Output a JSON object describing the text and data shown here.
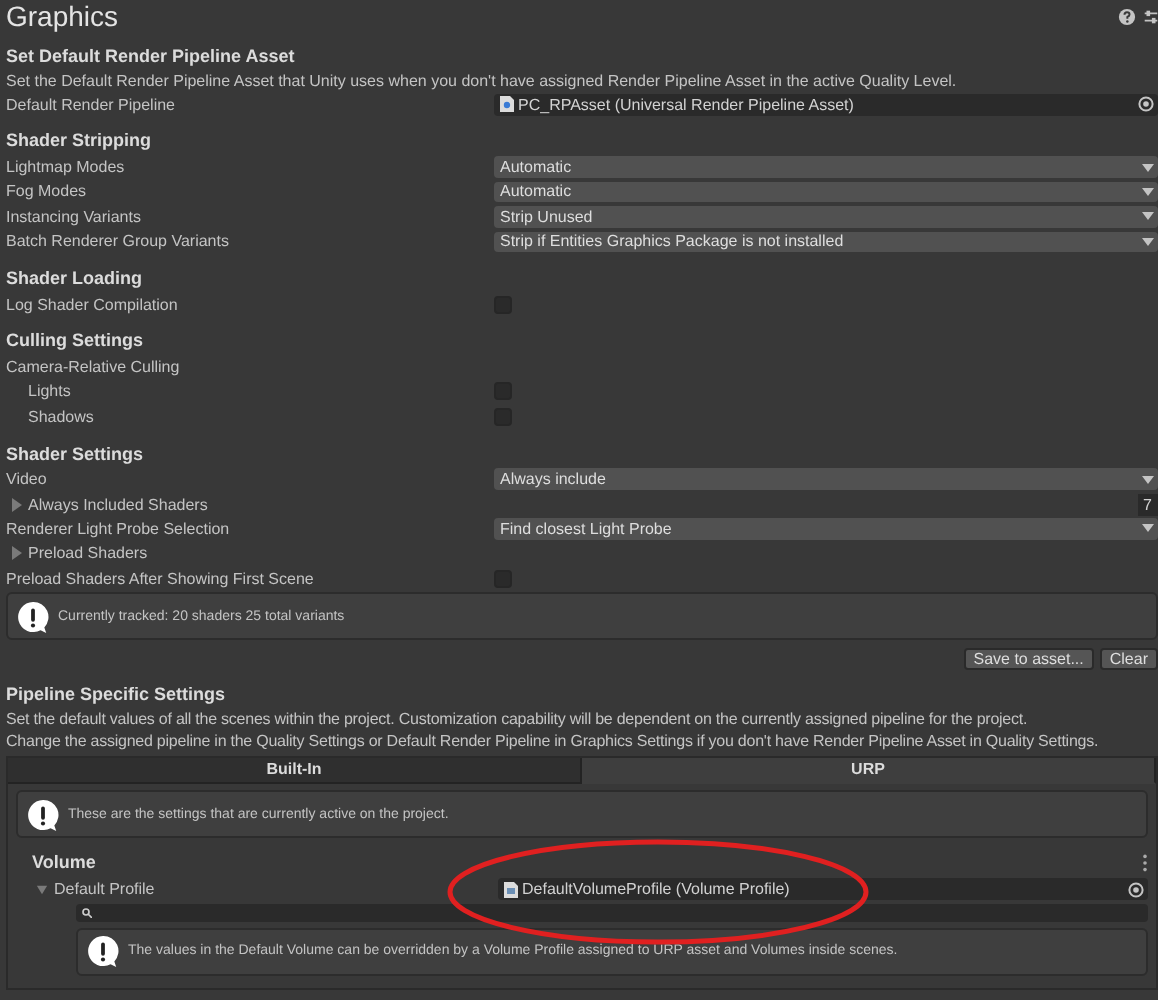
{
  "window": {
    "title": "Graphics"
  },
  "sections": [
    {
      "heading": "Set Default Render Pipeline Asset",
      "description": "Set the Default Render Pipeline Asset that Unity uses when you don't have assigned Render Pipeline Asset in the active Quality Level.",
      "rows": [
        {
          "kind": "object",
          "label": "Default Render Pipeline",
          "value": "PC_RPAsset (Universal Render Pipeline Asset)"
        }
      ]
    },
    {
      "heading": "Shader Stripping",
      "rows": [
        {
          "kind": "dropdown",
          "label": "Lightmap Modes",
          "value": "Automatic"
        },
        {
          "kind": "dropdown",
          "label": "Fog Modes",
          "value": "Automatic"
        },
        {
          "kind": "dropdown",
          "label": "Instancing Variants",
          "value": "Strip Unused"
        },
        {
          "kind": "dropdown",
          "label": "Batch Renderer Group Variants",
          "value": "Strip if Entities Graphics Package is not installed"
        }
      ]
    },
    {
      "heading": "Shader Loading",
      "rows": [
        {
          "kind": "checkbox",
          "label": "Log Shader Compilation",
          "checked": false
        }
      ]
    },
    {
      "heading": "Culling Settings",
      "rows": [
        {
          "kind": "group",
          "label": "Camera-Relative Culling",
          "children": [
            {
              "kind": "checkbox",
              "label": "Lights",
              "checked": false
            },
            {
              "kind": "checkbox",
              "label": "Shadows",
              "checked": false
            }
          ]
        }
      ]
    },
    {
      "heading": "Shader Settings",
      "rows": [
        {
          "kind": "dropdown",
          "label": "Video",
          "value": "Always include"
        },
        {
          "kind": "foldout",
          "label": "Always Included Shaders",
          "expanded": false,
          "value": "7"
        },
        {
          "kind": "dropdown",
          "label": "Renderer Light Probe Selection",
          "value": "Find closest Light Probe"
        },
        {
          "kind": "foldout",
          "label": "Preload Shaders",
          "expanded": false
        },
        {
          "kind": "checkbox",
          "label": "Preload Shaders After Showing First Scene",
          "checked": false
        }
      ],
      "note": "Currently tracked: 20 shaders 25 total variants",
      "buttons": [
        "Save to asset...",
        "Clear"
      ]
    }
  ],
  "pipeline": {
    "heading": "Pipeline Specific Settings",
    "description_lines": [
      "Set the default values of all the scenes within the project. Customization capability will be dependent on the currently assigned pipeline for the project.",
      "Change the assigned pipeline in the Quality Settings or Default Render Pipeline in Graphics Settings if you don't have Render Pipeline Asset in Quality Settings."
    ],
    "tabs": [
      {
        "label": "Built-In",
        "selected": false
      },
      {
        "label": "URP",
        "selected": true
      }
    ],
    "note": "These are the settings that are currently active on the project.",
    "volume": {
      "heading": "Volume",
      "profile": {
        "label": "Default Profile",
        "expanded": true,
        "value": "DefaultVolumeProfile (Volume Profile)"
      },
      "note": "The values in the Default Volume can be overridden by a Volume Profile assigned to URP asset and Volumes inside scenes."
    }
  }
}
